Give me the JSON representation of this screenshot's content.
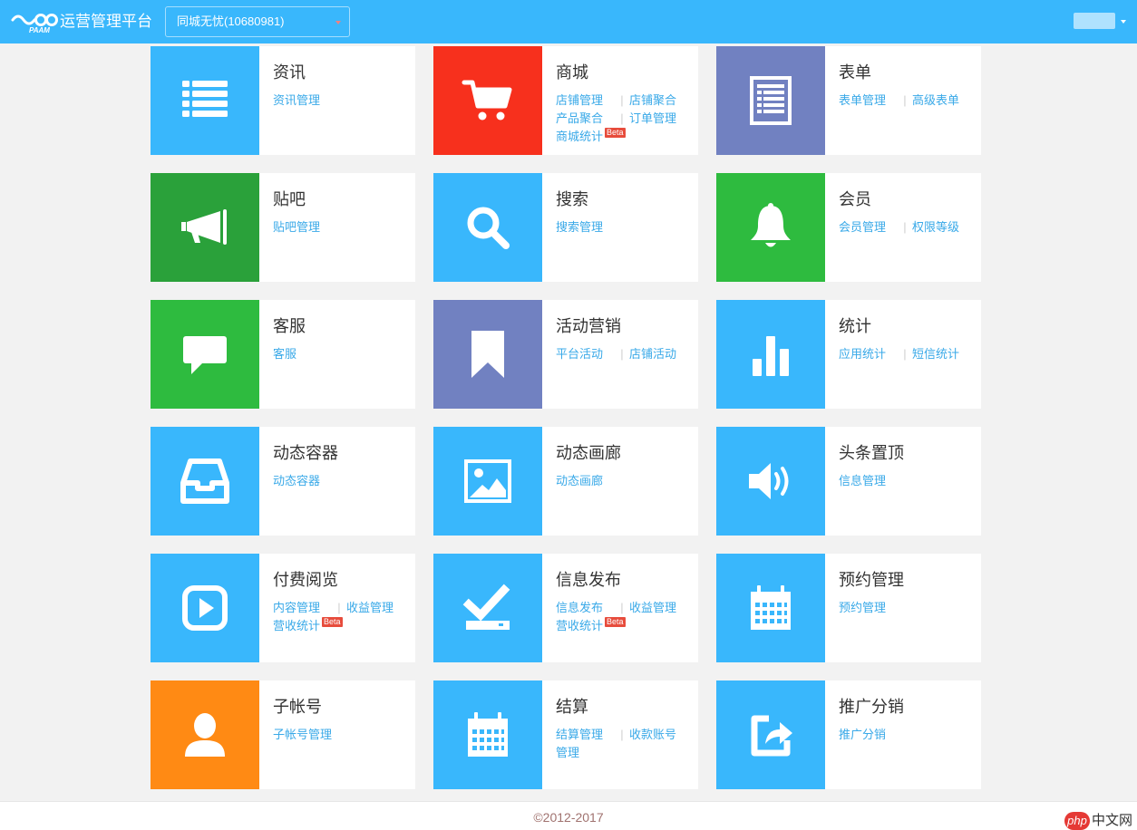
{
  "header": {
    "logo_text": "PAAM",
    "title": "运营管理平台",
    "selector_value": "同城无忧(10680981)"
  },
  "cards": [
    {
      "title": "资讯",
      "color": "#39b7fc",
      "icon": "list-icon",
      "links": [
        [
          "资讯管理"
        ]
      ]
    },
    {
      "title": "商城",
      "color": "#f7301d",
      "icon": "cart-icon",
      "links": [
        [
          "店铺管理",
          "店铺聚合"
        ],
        [
          "产品聚合",
          "订单管理"
        ],
        [
          "商城统计"
        ]
      ],
      "beta_row": 2
    },
    {
      "title": "表单",
      "color": "#7181c1",
      "icon": "form-icon",
      "links": [
        [
          "表单管理",
          "高级表单"
        ]
      ]
    },
    {
      "title": "贴吧",
      "color": "#2aa13a",
      "icon": "megaphone-icon",
      "links": [
        [
          "贴吧管理"
        ]
      ]
    },
    {
      "title": "搜索",
      "color": "#39b7fc",
      "icon": "search-icon",
      "links": [
        [
          "搜索管理"
        ]
      ]
    },
    {
      "title": "会员",
      "color": "#2ebb3f",
      "icon": "bell-icon",
      "links": [
        [
          "会员管理",
          "权限等级"
        ]
      ]
    },
    {
      "title": "客服",
      "color": "#2ebb3f",
      "icon": "chat-icon",
      "links": [
        [
          "客服"
        ]
      ]
    },
    {
      "title": "活动营销",
      "color": "#7181c1",
      "icon": "bookmark-icon",
      "links": [
        [
          "平台活动",
          "店铺活动"
        ]
      ]
    },
    {
      "title": "统计",
      "color": "#39b7fc",
      "icon": "bar-chart-icon",
      "links": [
        [
          "应用统计",
          "短信统计"
        ]
      ]
    },
    {
      "title": "动态容器",
      "color": "#39b7fc",
      "icon": "inbox-icon",
      "links": [
        [
          "动态容器"
        ]
      ]
    },
    {
      "title": "动态画廊",
      "color": "#39b7fc",
      "icon": "image-icon",
      "links": [
        [
          "动态画廊"
        ]
      ]
    },
    {
      "title": "头条置顶",
      "color": "#39b7fc",
      "icon": "speaker-icon",
      "links": [
        [
          "信息管理"
        ]
      ]
    },
    {
      "title": "付费阅览",
      "color": "#39b7fc",
      "icon": "play-icon",
      "links": [
        [
          "内容管理",
          "收益管理"
        ],
        [
          "营收统计"
        ]
      ],
      "beta_row": 1
    },
    {
      "title": "信息发布",
      "color": "#39b7fc",
      "icon": "check-tray-icon",
      "links": [
        [
          "信息发布",
          "收益管理"
        ],
        [
          "营收统计"
        ]
      ],
      "beta_row": 1
    },
    {
      "title": "预约管理",
      "color": "#39b7fc",
      "icon": "calendar-icon",
      "links": [
        [
          "预约管理"
        ]
      ]
    },
    {
      "title": "子帐号",
      "color": "#ff8a14",
      "icon": "user-icon",
      "links": [
        [
          "子帐号管理"
        ]
      ]
    },
    {
      "title": "结算",
      "color": "#39b7fc",
      "icon": "calendar-icon",
      "links": [
        [
          "结算管理",
          "收款账号"
        ],
        [
          "管理"
        ]
      ]
    },
    {
      "title": "推广分销",
      "color": "#39b7fc",
      "icon": "share-icon",
      "links": [
        [
          "推广分销"
        ]
      ]
    }
  ],
  "beta_label": "Beta",
  "footer": {
    "copyright": "©2012-2017"
  },
  "watermark": {
    "php": "php",
    "cn": "中文网"
  }
}
